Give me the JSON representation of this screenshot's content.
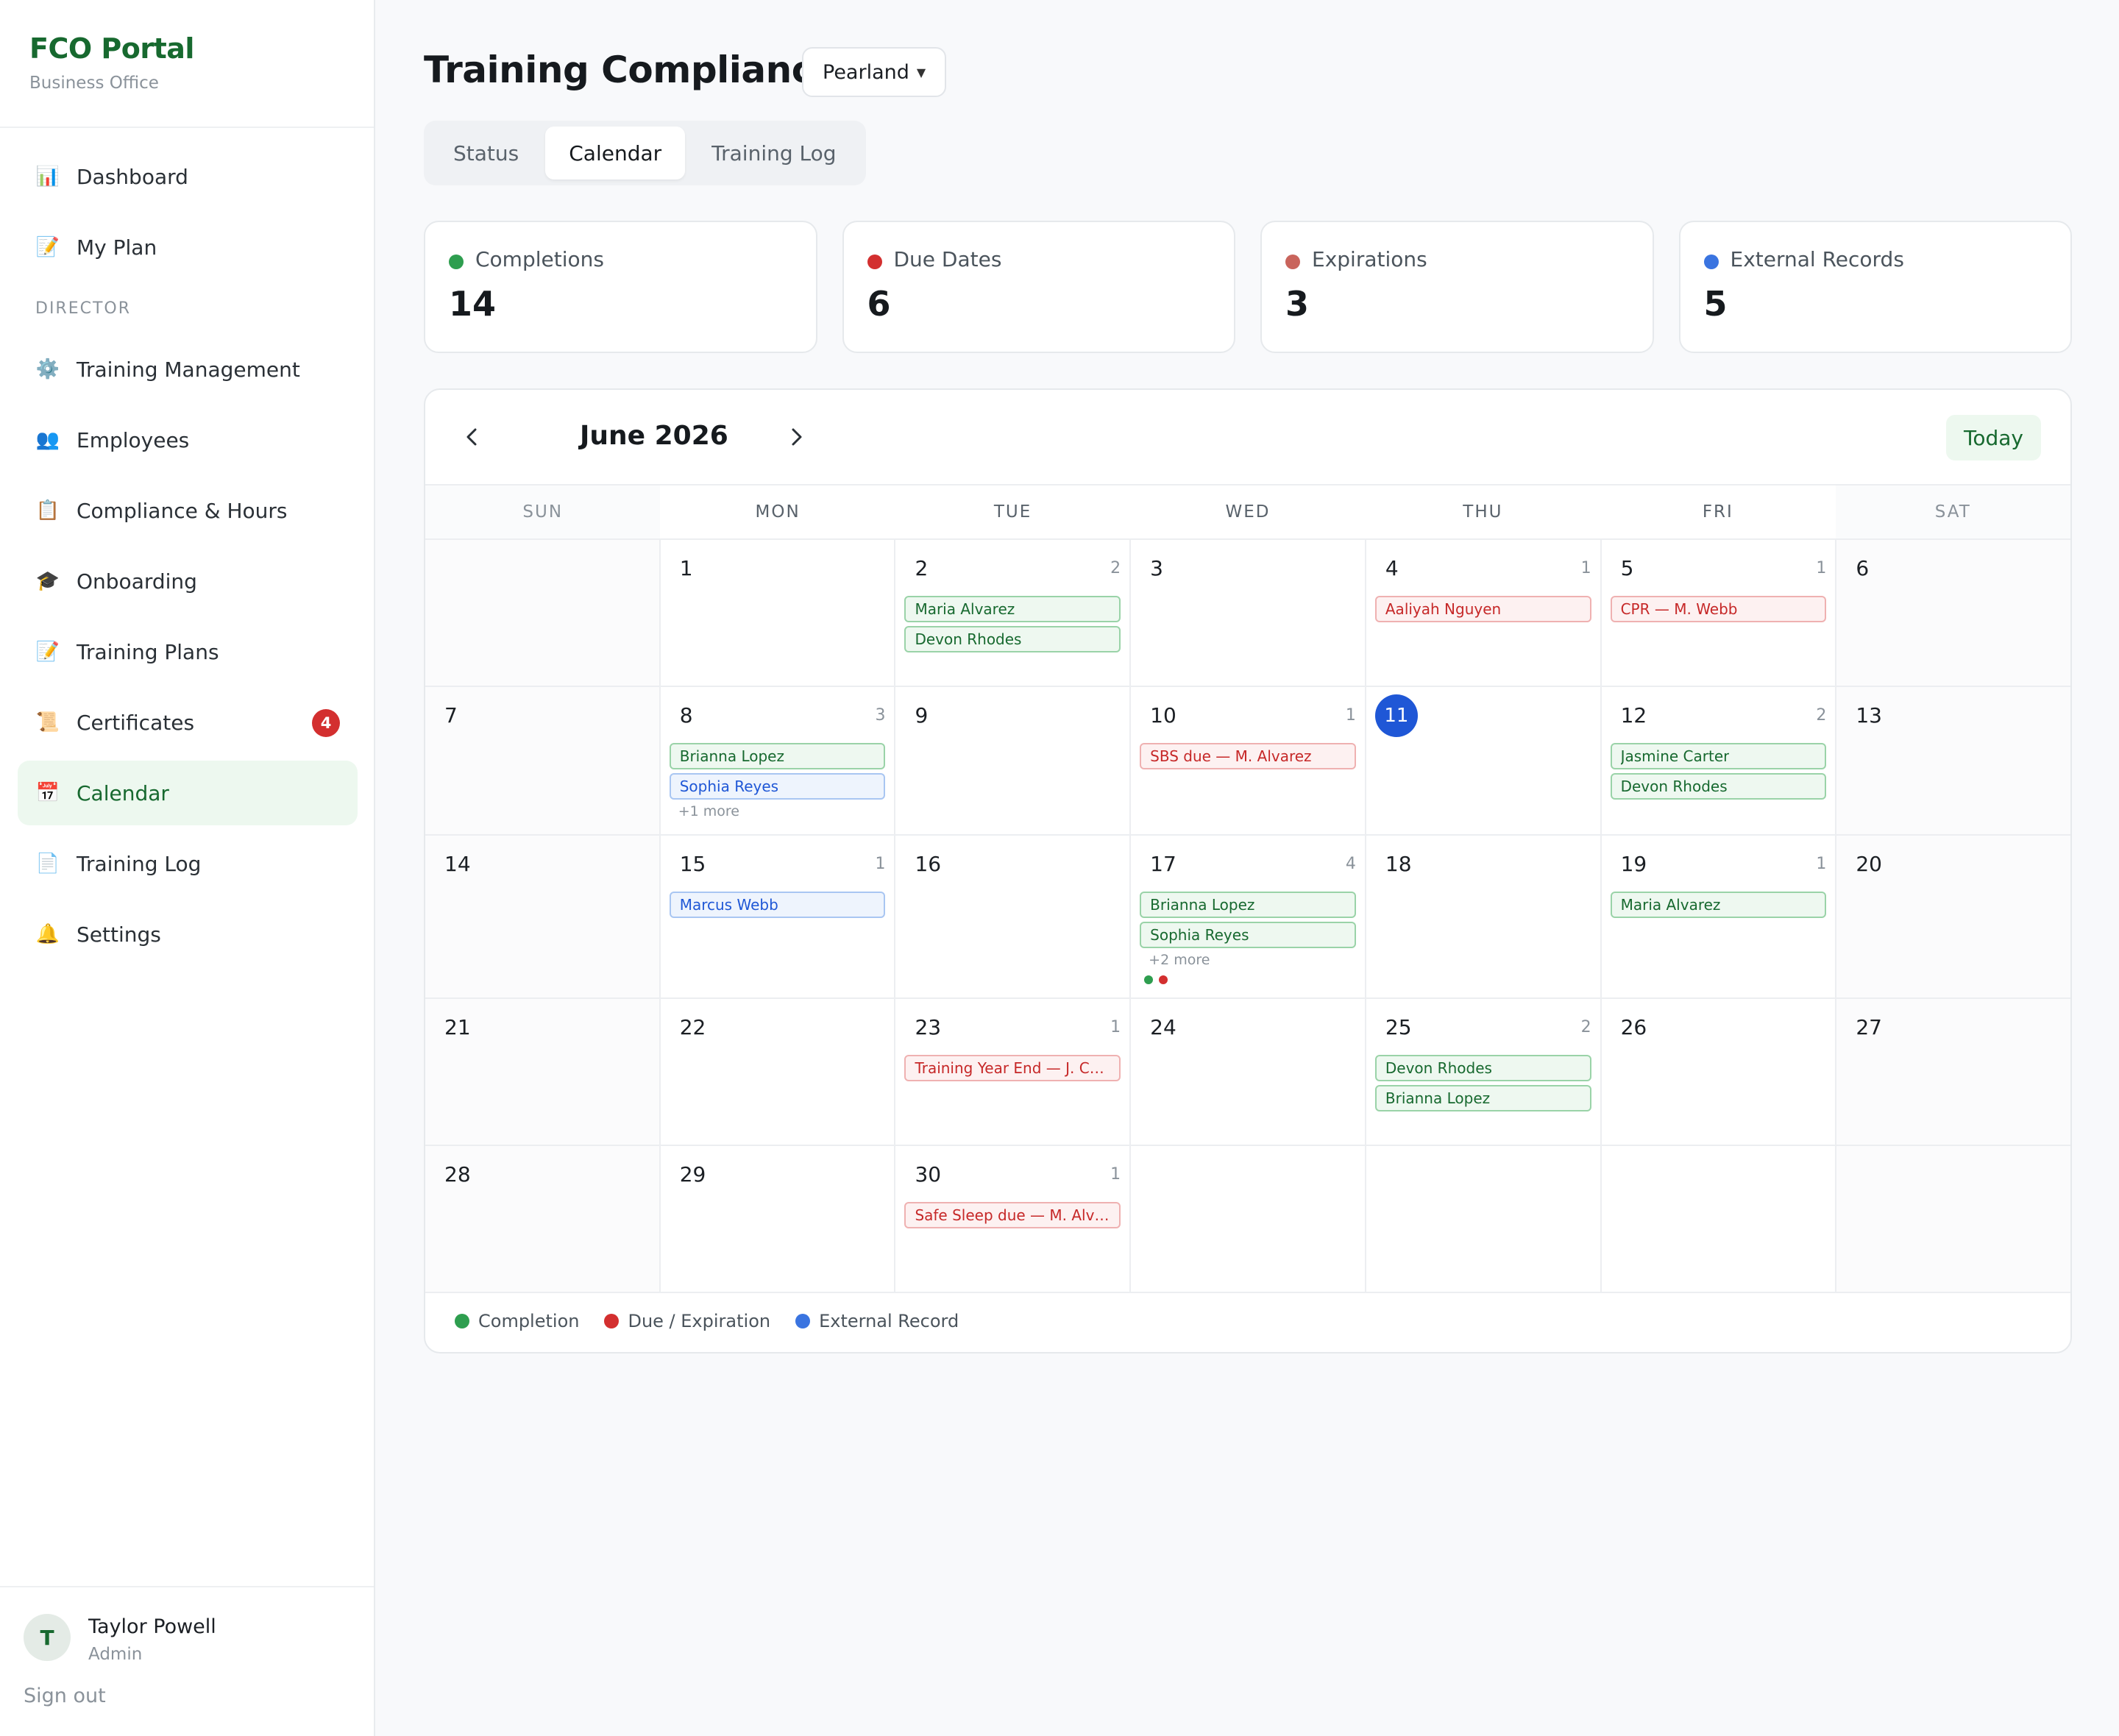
{
  "brand": {
    "title": "FCO Portal",
    "subtitle": "Business Office"
  },
  "nav": {
    "top": [
      {
        "id": "dashboard",
        "label": "Dashboard",
        "icon": "📊"
      },
      {
        "id": "my-plan",
        "label": "My Plan",
        "icon": "📝"
      }
    ],
    "section_label": "DIRECTOR",
    "director": [
      {
        "id": "training-management",
        "label": "Training Management",
        "icon": "⚙️"
      },
      {
        "id": "employees",
        "label": "Employees",
        "icon": "👥"
      },
      {
        "id": "compliance-hours",
        "label": "Compliance & Hours",
        "icon": "📋"
      },
      {
        "id": "onboarding",
        "label": "Onboarding",
        "icon": "🎓"
      },
      {
        "id": "training-plans",
        "label": "Training Plans",
        "icon": "📝"
      },
      {
        "id": "certificates",
        "label": "Certificates",
        "icon": "📜",
        "badge": "4"
      },
      {
        "id": "calendar",
        "label": "Calendar",
        "icon": "📅",
        "active": true
      },
      {
        "id": "training-log",
        "label": "Training Log",
        "icon": "📄"
      },
      {
        "id": "settings",
        "label": "Settings",
        "icon": "🔔"
      }
    ]
  },
  "user": {
    "initial": "T",
    "name": "Taylor Powell",
    "role": "Admin",
    "signout": "Sign out"
  },
  "header": {
    "title": "Training Compliance",
    "location": "Pearland"
  },
  "tabs": [
    {
      "label": "Status"
    },
    {
      "label": "Calendar",
      "active": true
    },
    {
      "label": "Training Log"
    }
  ],
  "stats": [
    {
      "label": "Completions",
      "value": "14",
      "color": "#2e9e4f"
    },
    {
      "label": "Due Dates",
      "value": "6",
      "color": "#d32f2f"
    },
    {
      "label": "Expirations",
      "value": "3",
      "color": "#c9645c"
    },
    {
      "label": "External Records",
      "value": "5",
      "color": "#3a74e0"
    }
  ],
  "calendar": {
    "month_label": "June 2026",
    "prev_icon": "chevron-left-icon",
    "next_icon": "chevron-right-icon",
    "today_label": "Today",
    "days_of_week": [
      "SUN",
      "MON",
      "TUE",
      "WED",
      "THU",
      "FRI",
      "SAT"
    ],
    "today": 11,
    "weeks": [
      [
        {
          "day": ""
        },
        {
          "day": "1"
        },
        {
          "day": "2",
          "count": "2",
          "events": [
            {
              "type": "completion",
              "text": "Maria Alvarez"
            },
            {
              "type": "completion",
              "text": "Devon Rhodes"
            }
          ]
        },
        {
          "day": "3"
        },
        {
          "day": "4",
          "count": "1",
          "events": [
            {
              "type": "due",
              "text": "Aaliyah Nguyen"
            }
          ]
        },
        {
          "day": "5",
          "count": "1",
          "events": [
            {
              "type": "due",
              "text": "CPR — M. Webb"
            }
          ]
        },
        {
          "day": "6"
        }
      ],
      [
        {
          "day": "7"
        },
        {
          "day": "8",
          "count": "3",
          "events": [
            {
              "type": "completion",
              "text": "Brianna Lopez"
            },
            {
              "type": "external",
              "text": "Sophia Reyes"
            }
          ],
          "more": "+1 more"
        },
        {
          "day": "9"
        },
        {
          "day": "10",
          "count": "1",
          "events": [
            {
              "type": "due",
              "text": "SBS due — M. Alvarez"
            }
          ]
        },
        {
          "day": "11",
          "today": true
        },
        {
          "day": "12",
          "count": "2",
          "events": [
            {
              "type": "completion",
              "text": "Jasmine Carter"
            },
            {
              "type": "completion",
              "text": "Devon Rhodes"
            }
          ]
        },
        {
          "day": "13"
        }
      ],
      [
        {
          "day": "14"
        },
        {
          "day": "15",
          "count": "1",
          "events": [
            {
              "type": "external",
              "text": "Marcus Webb"
            }
          ]
        },
        {
          "day": "16"
        },
        {
          "day": "17",
          "count": "4",
          "events": [
            {
              "type": "completion",
              "text": "Brianna Lopez"
            },
            {
              "type": "completion",
              "text": "Sophia Reyes"
            }
          ],
          "more": "+2 more",
          "dots": [
            "#2e9e4f",
            "#d32f2f"
          ]
        },
        {
          "day": "18"
        },
        {
          "day": "19",
          "count": "1",
          "events": [
            {
              "type": "completion",
              "text": "Maria Alvarez"
            }
          ]
        },
        {
          "day": "20"
        }
      ],
      [
        {
          "day": "21"
        },
        {
          "day": "22"
        },
        {
          "day": "23",
          "count": "1",
          "events": [
            {
              "type": "due",
              "text": "Training Year End — J. Carter"
            }
          ]
        },
        {
          "day": "24"
        },
        {
          "day": "25",
          "count": "2",
          "events": [
            {
              "type": "completion",
              "text": "Devon Rhodes"
            },
            {
              "type": "completion",
              "text": "Brianna Lopez"
            }
          ]
        },
        {
          "day": "26"
        },
        {
          "day": "27"
        }
      ],
      [
        {
          "day": "28"
        },
        {
          "day": "29"
        },
        {
          "day": "30",
          "count": "1",
          "events": [
            {
              "type": "due",
              "text": "Safe Sleep due — M. Alvarez"
            }
          ]
        },
        {
          "day": ""
        },
        {
          "day": ""
        },
        {
          "day": ""
        },
        {
          "day": ""
        }
      ]
    ],
    "legend": [
      {
        "label": "Completion",
        "color": "#2e9e4f"
      },
      {
        "label": "Due / Expiration",
        "color": "#d32f2f"
      },
      {
        "label": "External Record",
        "color": "#3a74e0"
      }
    ]
  }
}
